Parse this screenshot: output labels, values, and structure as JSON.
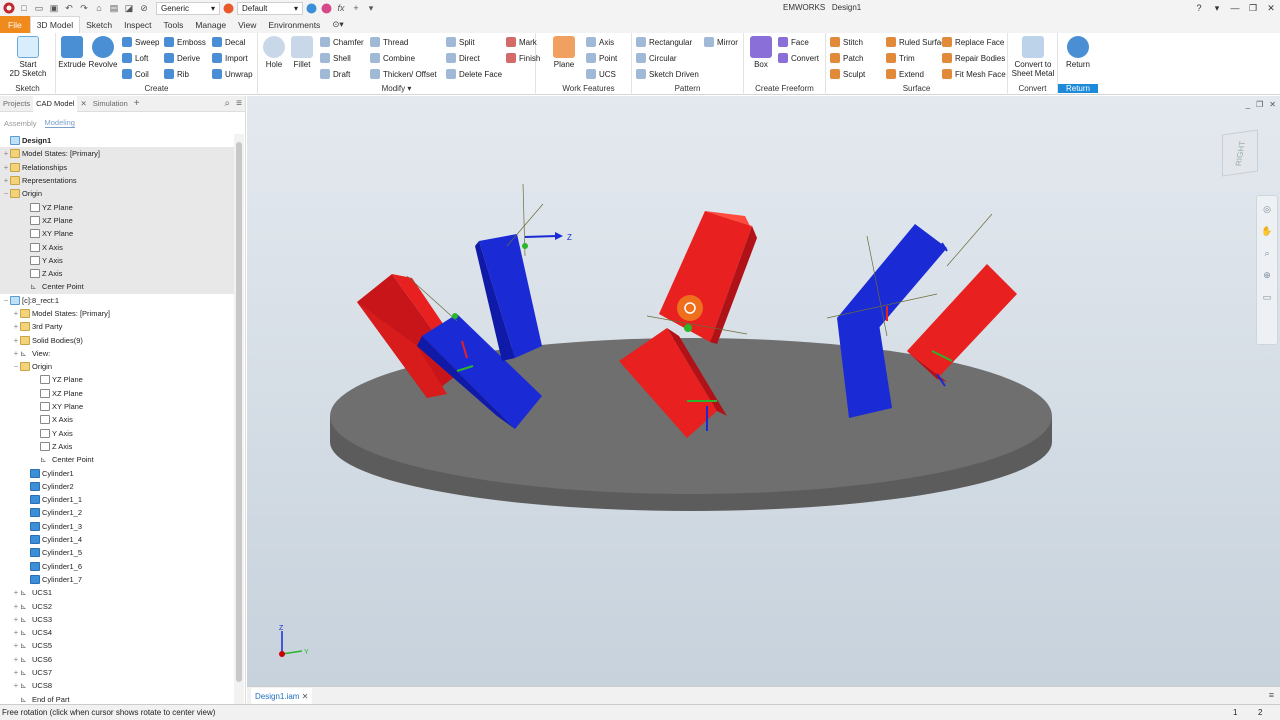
{
  "window": {
    "title": "EMWORKS",
    "doc": "Design1",
    "appearance": "Generic",
    "view_style": "Default"
  },
  "menu": [
    "File",
    "3D Model",
    "Sketch",
    "Inspect",
    "Tools",
    "Manage",
    "View",
    "Environments"
  ],
  "ribbon": {
    "sketch": {
      "label": "Sketch",
      "start": "Start\n2D Sketch"
    },
    "create": {
      "label": "Create",
      "extrude": "Extrude",
      "revolve": "Revolve",
      "sweep": "Sweep",
      "loft": "Loft",
      "coil": "Coil",
      "emboss": "Emboss",
      "derive": "Derive",
      "rib": "Rib",
      "decal": "Decal",
      "import": "Import",
      "unwrap": "Unwrap"
    },
    "modify": {
      "label": "Modify",
      "hole": "Hole",
      "fillet": "Fillet",
      "chamfer": "Chamfer",
      "shell": "Shell",
      "draft": "Draft",
      "thread": "Thread",
      "combine": "Combine",
      "thicken": "Thicken/ Offset",
      "split": "Split",
      "direct": "Direct",
      "delete_face": "Delete Face"
    },
    "work": {
      "label": "Work Features",
      "plane": "Plane",
      "axis": "Axis",
      "point": "Point",
      "ucs": "UCS",
      "mark": "Mark",
      "finish": "Finish"
    },
    "pattern": {
      "label": "Pattern",
      "rect": "Rectangular",
      "circ": "Circular",
      "sketch_driven": "Sketch Driven",
      "mirror": "Mirror"
    },
    "freeform": {
      "label": "Create Freeform",
      "box": "Box",
      "face": "Face",
      "convert": "Convert"
    },
    "surface": {
      "label": "Surface",
      "stitch": "Stitch",
      "patch": "Patch",
      "sculpt": "Sculpt",
      "ruled": "Ruled Surface",
      "trim": "Trim",
      "extend": "Extend",
      "replace": "Replace Face",
      "repair": "Repair Bodies",
      "fitmesh": "Fit Mesh Face"
    },
    "convert": {
      "label": "Convert",
      "sheet": "Convert to\nSheet Metal"
    },
    "return": {
      "label": "Return",
      "btn": "Return"
    }
  },
  "panel": {
    "tabs": [
      "Projects",
      "CAD Model",
      "Simulation"
    ],
    "subtabs": [
      "Assembly",
      "Modeling"
    ],
    "tree": [
      {
        "t": "Design1",
        "lvl": 0,
        "icon": "doc",
        "bold": true
      },
      {
        "t": "Model States: [Primary]",
        "lvl": 0,
        "icon": "folder",
        "pm": "+",
        "grey": true
      },
      {
        "t": "Relationships",
        "lvl": 0,
        "icon": "folder",
        "pm": "+",
        "grey": true
      },
      {
        "t": "Representations",
        "lvl": 0,
        "icon": "folder",
        "pm": "+",
        "grey": true
      },
      {
        "t": "Origin",
        "lvl": 0,
        "icon": "folder",
        "pm": "−",
        "grey": true
      },
      {
        "t": "YZ Plane",
        "lvl": 2,
        "icon": "plane",
        "grey": true
      },
      {
        "t": "XZ Plane",
        "lvl": 2,
        "icon": "plane",
        "grey": true
      },
      {
        "t": "XY Plane",
        "lvl": 2,
        "icon": "plane",
        "grey": true
      },
      {
        "t": "X Axis",
        "lvl": 2,
        "icon": "plane",
        "grey": true
      },
      {
        "t": "Y Axis",
        "lvl": 2,
        "icon": "plane",
        "grey": true
      },
      {
        "t": "Z Axis",
        "lvl": 2,
        "icon": "plane",
        "grey": true
      },
      {
        "t": "Center Point",
        "lvl": 2,
        "icon": "ucs",
        "grey": true
      },
      {
        "t": "[c]:8_rect:1",
        "lvl": 0,
        "icon": "doc",
        "pm": "−"
      },
      {
        "t": "Model States: [Primary]",
        "lvl": 1,
        "icon": "folder",
        "pm": "+"
      },
      {
        "t": "3rd Party",
        "lvl": 1,
        "icon": "folder",
        "pm": "+"
      },
      {
        "t": "Solid Bodies(9)",
        "lvl": 1,
        "icon": "folder",
        "pm": "+"
      },
      {
        "t": "View:",
        "lvl": 1,
        "icon": "ucs",
        "pm": "+"
      },
      {
        "t": "Origin",
        "lvl": 1,
        "icon": "folder",
        "pm": "−"
      },
      {
        "t": "YZ Plane",
        "lvl": 3,
        "icon": "plane"
      },
      {
        "t": "XZ Plane",
        "lvl": 3,
        "icon": "plane"
      },
      {
        "t": "XY Plane",
        "lvl": 3,
        "icon": "plane"
      },
      {
        "t": "X Axis",
        "lvl": 3,
        "icon": "plane"
      },
      {
        "t": "Y Axis",
        "lvl": 3,
        "icon": "plane"
      },
      {
        "t": "Z Axis",
        "lvl": 3,
        "icon": "plane"
      },
      {
        "t": "Center Point",
        "lvl": 3,
        "icon": "ucs"
      },
      {
        "t": "Cylinder1",
        "lvl": 2,
        "icon": "cyl"
      },
      {
        "t": "Cylinder2",
        "lvl": 2,
        "icon": "cyl"
      },
      {
        "t": "Cylinder1_1",
        "lvl": 2,
        "icon": "cyl"
      },
      {
        "t": "Cylinder1_2",
        "lvl": 2,
        "icon": "cyl"
      },
      {
        "t": "Cylinder1_3",
        "lvl": 2,
        "icon": "cyl"
      },
      {
        "t": "Cylinder1_4",
        "lvl": 2,
        "icon": "cyl"
      },
      {
        "t": "Cylinder1_5",
        "lvl": 2,
        "icon": "cyl"
      },
      {
        "t": "Cylinder1_6",
        "lvl": 2,
        "icon": "cyl"
      },
      {
        "t": "Cylinder1_7",
        "lvl": 2,
        "icon": "cyl"
      },
      {
        "t": "UCS1",
        "lvl": 1,
        "icon": "ucs",
        "pm": "+"
      },
      {
        "t": "UCS2",
        "lvl": 1,
        "icon": "ucs",
        "pm": "+"
      },
      {
        "t": "UCS3",
        "lvl": 1,
        "icon": "ucs",
        "pm": "+"
      },
      {
        "t": "UCS4",
        "lvl": 1,
        "icon": "ucs",
        "pm": "+"
      },
      {
        "t": "UCS5",
        "lvl": 1,
        "icon": "ucs",
        "pm": "+"
      },
      {
        "t": "UCS6",
        "lvl": 1,
        "icon": "ucs",
        "pm": "+"
      },
      {
        "t": "UCS7",
        "lvl": 1,
        "icon": "ucs",
        "pm": "+"
      },
      {
        "t": "UCS8",
        "lvl": 1,
        "icon": "ucs",
        "pm": "+"
      },
      {
        "t": "End of Part",
        "lvl": 1,
        "icon": "ucs"
      }
    ]
  },
  "viewcube": {
    "face": "RIGHT"
  },
  "triad": {
    "z": "Z",
    "y": "Y"
  },
  "doc_tab": "Design1.iam",
  "status": {
    "text": "Free rotation (click when cursor shows rotate to center view)",
    "n1": "1",
    "n2": "2"
  },
  "colors": {
    "accent": "#f08a1c",
    "blue_part": "#1a2bd6",
    "red_part": "#e8201f",
    "platform": "#6f6f6f",
    "return_active": "#1c8ad9"
  }
}
